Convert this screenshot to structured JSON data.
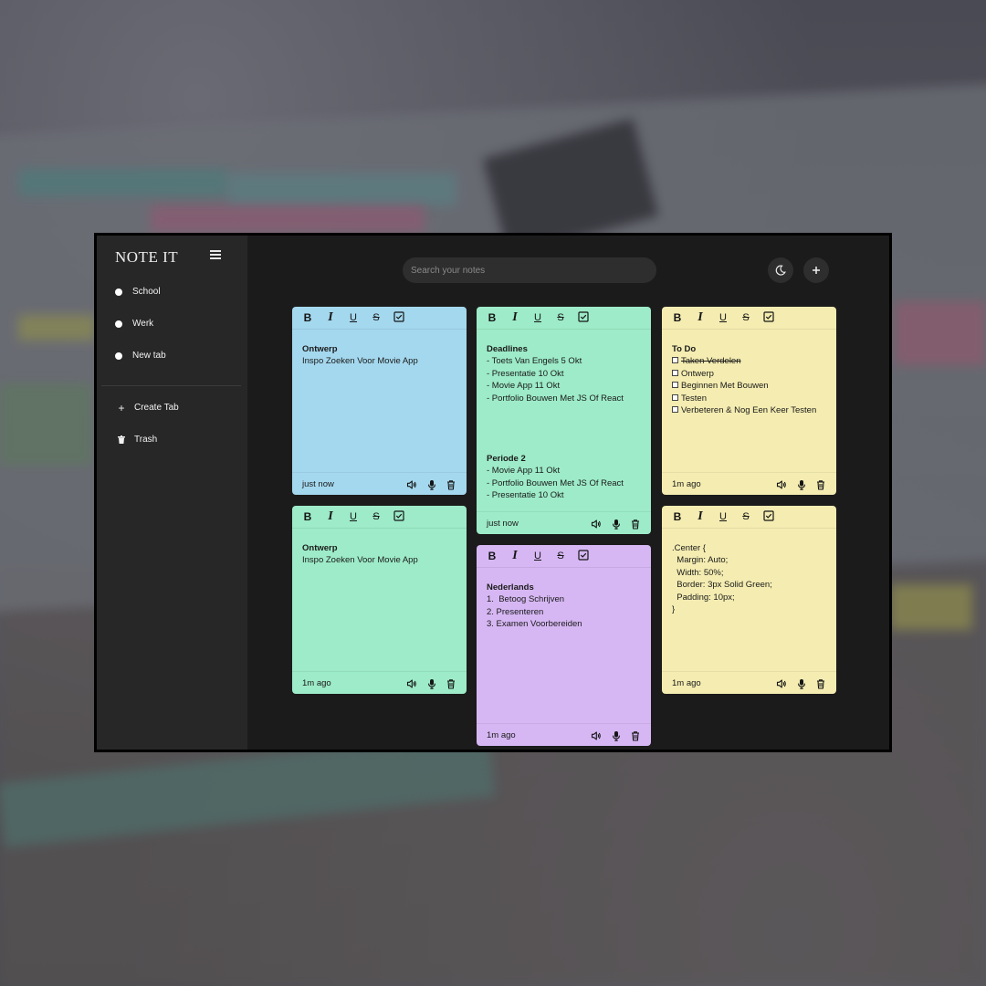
{
  "app": {
    "logo": "NOTE IT",
    "sidebar": {
      "tabs": [
        {
          "label": "School"
        },
        {
          "label": "Werk"
        },
        {
          "label": "New tab"
        }
      ],
      "actions": [
        {
          "label": "Create Tab",
          "icon": "plus-icon"
        },
        {
          "label": "Trash",
          "icon": "trash-icon"
        }
      ]
    },
    "header": {
      "search_placeholder": "Search your notes",
      "theme_icon": "moon-icon",
      "add_icon": "plus-icon"
    },
    "toolbar_labels": {
      "bold": "B",
      "italic": "I",
      "underline": "U",
      "strike": "S"
    },
    "notes": [
      {
        "color": "#a4d8ee",
        "title": "Ontwerp",
        "lines": [
          "Inspo Zoeken Voor Movie App"
        ],
        "timestamp": "just now"
      },
      {
        "color": "#9debc8",
        "title": "Ontwerp",
        "lines": [
          "Inspo Zoeken Voor Movie App"
        ],
        "timestamp": "1m ago"
      },
      {
        "color": "#9debc8",
        "title": "Deadlines",
        "lines": [
          "- Toets Van Engels 5 Okt",
          "- Presentatie 10 Okt",
          "- Movie App 11 Okt",
          "- Portfolio Bouwen Met JS Of React"
        ],
        "title2": "Periode 2",
        "lines2": [
          "- Movie App 11 Okt",
          "- Portfolio Bouwen Met JS Of React",
          "- Presentatie 10 Okt"
        ],
        "timestamp": "just now"
      },
      {
        "color": "#d6b7f3",
        "title": "Nederlands",
        "lines": [
          "1.  Betoog Schrijven",
          "2. Presenteren",
          "3. Examen Voorbereiden"
        ],
        "timestamp": "1m ago"
      },
      {
        "color": "#f4ecb1",
        "title": "To Do",
        "checklist": [
          {
            "text": "Taken Verdelen",
            "done": true
          },
          {
            "text": "Ontwerp",
            "done": false
          },
          {
            "text": "Beginnen Met Bouwen",
            "done": false
          },
          {
            "text": "Testen",
            "done": false
          },
          {
            "text": "Verbeteren & Nog Een Keer Testen",
            "done": false
          }
        ],
        "timestamp": "1m ago"
      },
      {
        "color": "#f4ecb1",
        "lines": [
          ".Center {",
          "  Margin: Auto;",
          "  Width: 50%;",
          "  Border: 3px Solid Green;",
          "  Padding: 10px;",
          "}"
        ],
        "timestamp": "1m ago"
      }
    ],
    "footer_icons": [
      "speaker-icon",
      "microphone-icon",
      "trash-icon"
    ]
  }
}
